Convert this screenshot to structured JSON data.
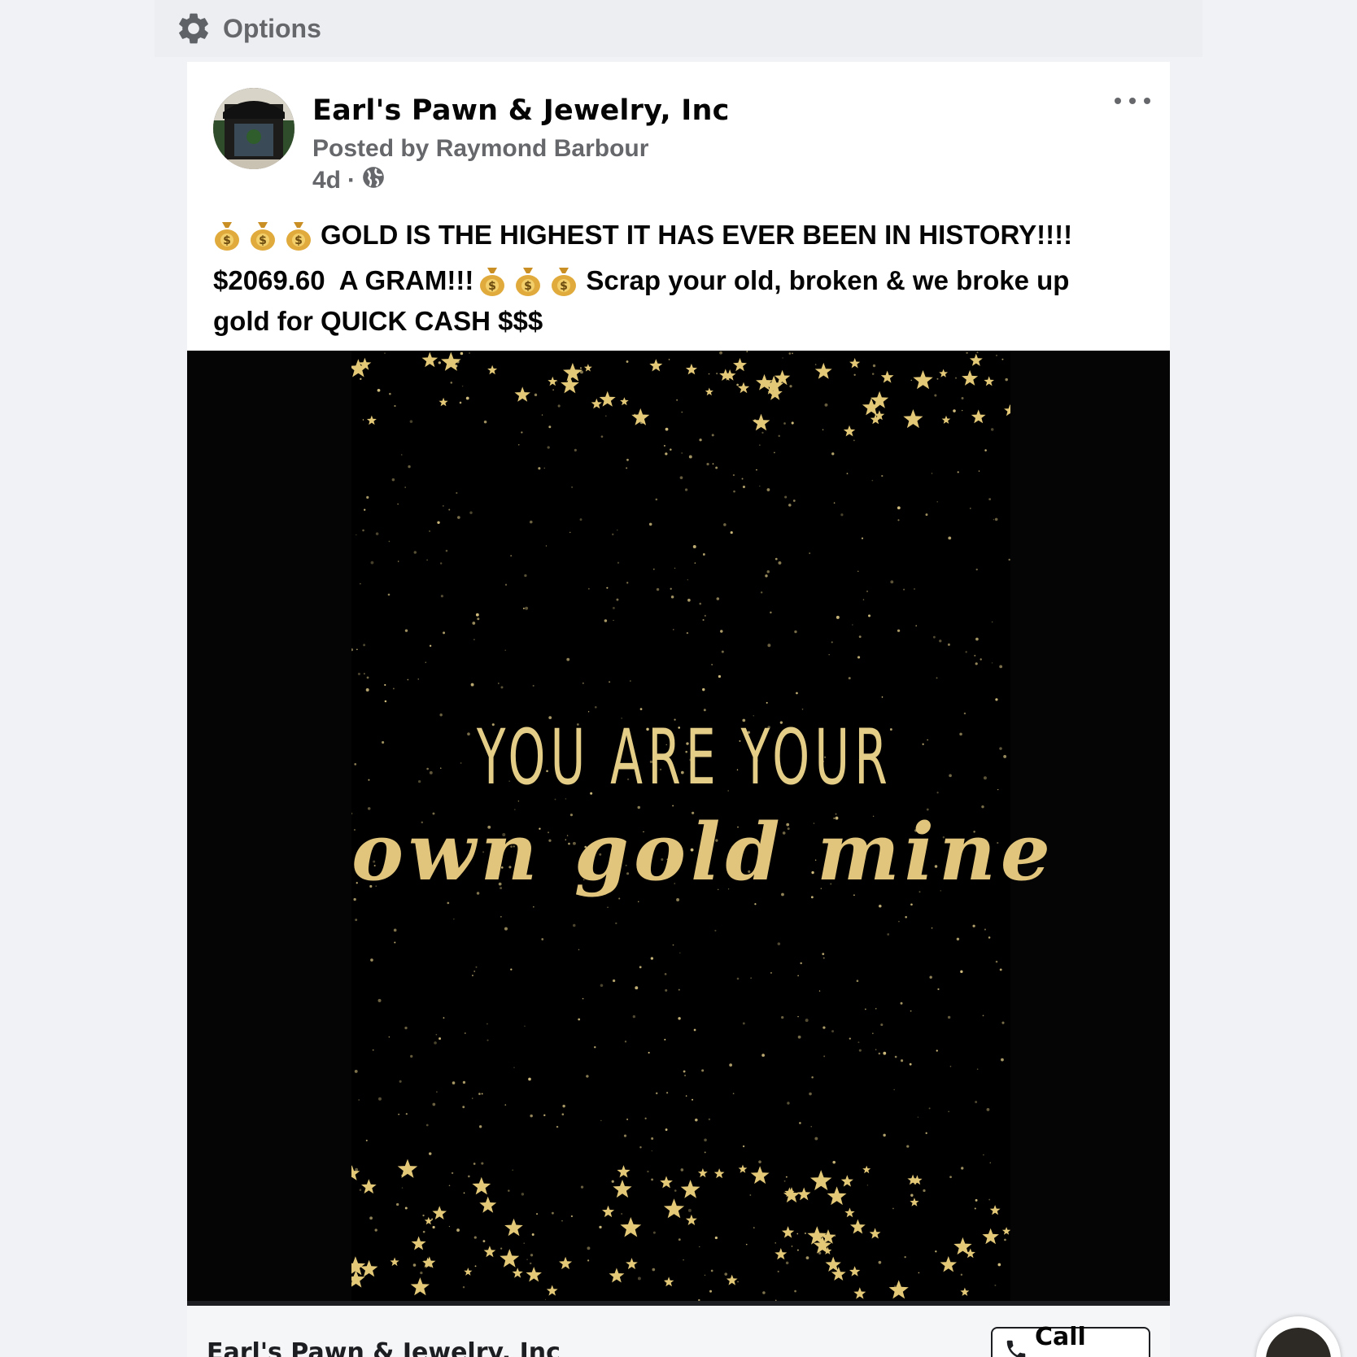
{
  "options_bar": {
    "label": "Options",
    "icon": "gear-icon"
  },
  "post": {
    "page_name": "Earl's Pawn & Jewelry, Inc",
    "posted_by": "Posted by Raymond Barbour",
    "time": "4d",
    "separator": "·",
    "privacy_icon": "globe-icon",
    "more_icon": "more-options-icon",
    "text": {
      "line1": "GOLD IS THE HIGHEST IT HAS EVER BEEN IN HISTORY!!!!",
      "line2a": "$2069.60  A GRAM!!!",
      "line2b": "Scrap your old, broken & we broke up",
      "line3": "gold for QUICK CASH $$$"
    },
    "emoji": "money-bag-icon",
    "image": {
      "headline_top": "YOU ARE YOUR",
      "headline_bottom": "own gold mine"
    }
  },
  "cta": {
    "page_name": "Earl's Pawn & Jewelry, Inc",
    "button_label": "Call now",
    "button_icon": "phone-icon"
  },
  "colors": {
    "background": "#f0f2f5",
    "card": "#ffffff",
    "secondary_text": "#65676b",
    "gold": "#e4cd86",
    "image_bg": "#000000"
  }
}
